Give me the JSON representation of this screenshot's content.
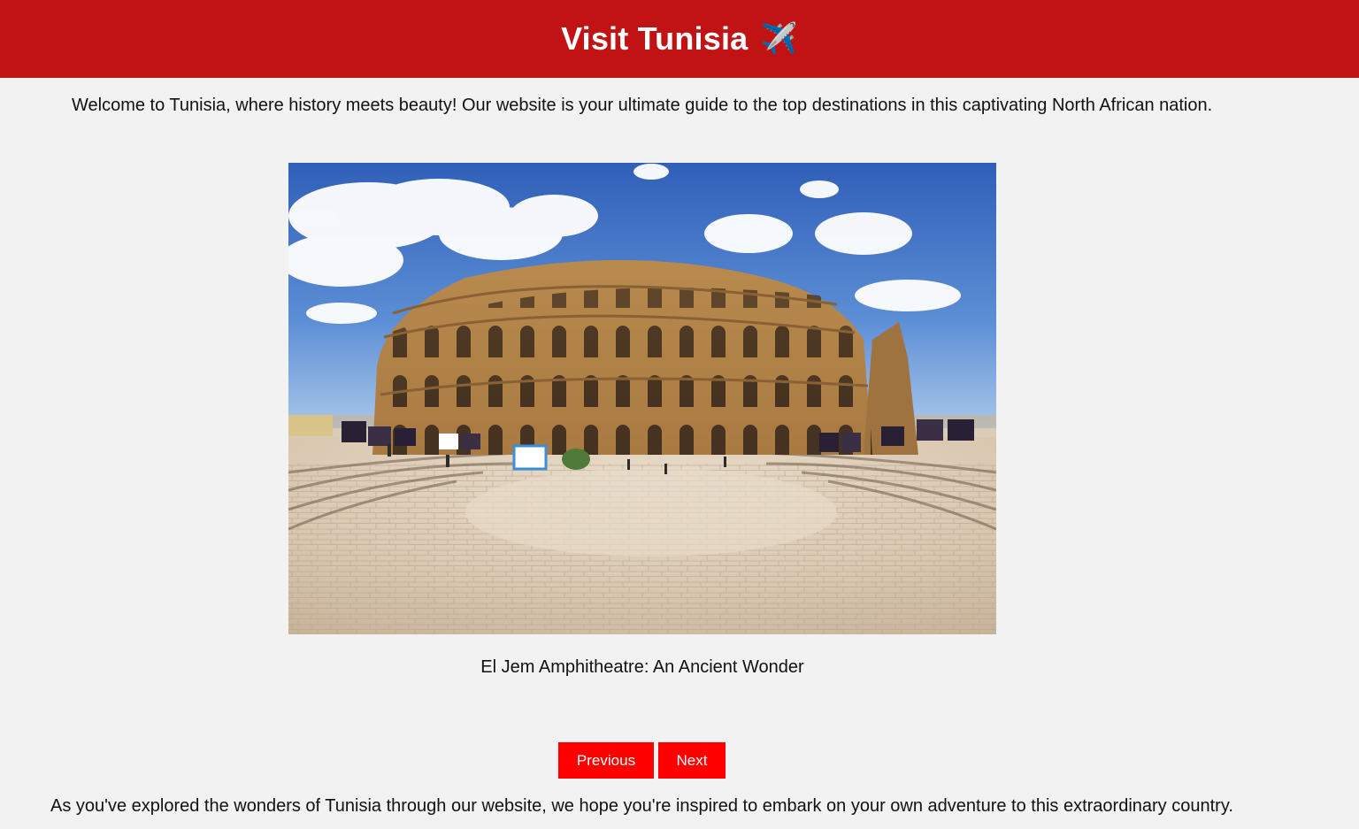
{
  "header": {
    "title": "Visit Tunisia",
    "emoji": "✈️",
    "background_color": "#c11313"
  },
  "intro_text": "Welcome to Tunisia, where history meets beauty! Our website is your ultimate guide to the top destinations in this captivating North African nation.",
  "slideshow": {
    "image_icon": "el-jem-amphitheatre-photo",
    "caption": "El Jem Amphitheatre: An Ancient Wonder",
    "previous_label": "Previous",
    "next_label": "Next",
    "button_color": "#ff0000"
  },
  "outro_text": "As you've explored the wonders of Tunisia through our website, we hope you're inspired to embark on your own adventure to this extraordinary country."
}
